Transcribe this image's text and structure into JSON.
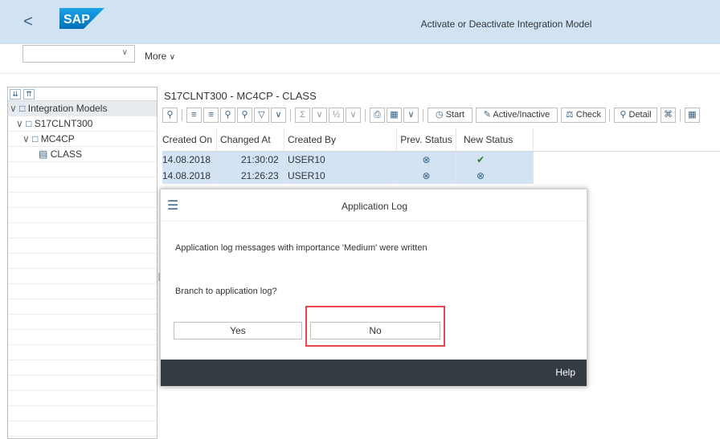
{
  "shell": {
    "back": "<",
    "logo": "SAP",
    "title": "Activate or Deactivate Integration Model"
  },
  "toolbar": {
    "combo_value": "",
    "more": "More"
  },
  "tree": {
    "nodes": [
      {
        "label": "Integration Models",
        "level": 0
      },
      {
        "label": "S17CLNT300",
        "level": 1
      },
      {
        "label": "MC4CP",
        "level": 2
      },
      {
        "label": "CLASS",
        "level": 3
      }
    ]
  },
  "main": {
    "title": "S17CLNT300 - MC4CP - CLASS",
    "toolbar_buttons": {
      "start": "Start",
      "active_inactive": "Active/Inactive",
      "check": "Check",
      "detail": "Detail"
    }
  },
  "grid": {
    "columns": [
      "Created On",
      "Changed At",
      "Created By",
      "Prev. Status",
      "New Status"
    ],
    "rows": [
      {
        "created_on": "14.08.2018",
        "changed_at": "21:30:02",
        "created_by": "USER10",
        "prev_status": "inactive",
        "new_status": "active"
      },
      {
        "created_on": "14.08.2018",
        "changed_at": "21:26:23",
        "created_by": "USER10",
        "prev_status": "inactive",
        "new_status": "inactive"
      }
    ]
  },
  "dialog": {
    "title": "Application Log",
    "message": "Application log messages with importance 'Medium' were written",
    "question": "Branch to application log?",
    "yes": "Yes",
    "no": "No",
    "help": "Help"
  },
  "colors": {
    "shell_bg": "#d1e2f2",
    "selected_row": "#d3e3f3",
    "dialog_footer": "#343b43",
    "highlight": "#e8484b",
    "ok_green": "#2b7d2b",
    "icon_blue": "#346187"
  }
}
